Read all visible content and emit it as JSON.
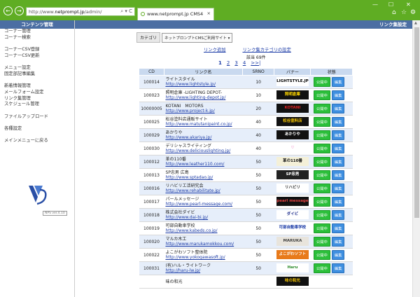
{
  "browser": {
    "url_prefix": "http://www.",
    "url_host": "netprompt.jp",
    "url_path": "/admin/",
    "url_ctl": "⌕ ▾ C",
    "tab_title": "www.netprompt.jp  CMS4",
    "tab_close": "×",
    "win_min": "—",
    "win_max": "☐",
    "win_close": "✕"
  },
  "left": {
    "heading": "コンテンツ管理",
    "menu": [
      [
        "コーナー管理",
        "コーナー検索"
      ],
      [
        "コーナーCSV登録",
        "コーナーCSV更新"
      ],
      [
        "メニュー設定",
        "固定部記事編集"
      ],
      [
        "新着情報管理",
        "メールフォーム設定",
        "リンク集管理",
        "スケジュール管理"
      ],
      [
        "ファイルアップロード"
      ],
      [
        "各種設定"
      ],
      [
        "メインメニューに戻る"
      ]
    ],
    "version": "NPS ver.4.10"
  },
  "main": {
    "heading": "リンク集設定",
    "cat_label": "カテゴリ",
    "cat_value": "ネットプロンプトCMSご利用サイト ▾",
    "add_link": "リンク追加",
    "cat_setting": "リンク集カテゴリの設定",
    "total": "該当 69件",
    "pages": [
      "1",
      "2",
      "3",
      "4",
      ">>|"
    ],
    "cols": [
      "CD",
      "リンク名",
      "SRNO",
      "バナー",
      "状態"
    ],
    "pub_label": "公開中",
    "edit_label": "編集"
  },
  "rows": [
    {
      "cd": "100014",
      "name": "ライトスタイル",
      "url": "http://www.lightstyle.jp/",
      "srno": "10",
      "banner": "LIGHTSTYLE.JP",
      "bg": "#ffffff",
      "fg": "#000000"
    },
    {
      "cd": "100023",
      "name": "照明倉庫 -LIGHTING DEPOT-",
      "url": "http://www.lighting-depot.jp/",
      "srno": "10",
      "banner": "照明倉庫",
      "bg": "#111111",
      "fg": "#ffd700"
    },
    {
      "cd": "10000005",
      "name": "KOTANI　MOTORS",
      "url": "http://www.project-k.jp/",
      "srno": "20",
      "banner": "KOTANI",
      "bg": "#111111",
      "fg": "#e02020"
    },
    {
      "cd": "100025",
      "name": "松谷塗料店通販サイト",
      "url": "http://www.matutanipaint.co.jp/",
      "srno": "40",
      "banner": "松谷塗料店",
      "bg": "#111111",
      "fg": "#f0c000"
    },
    {
      "cd": "100029",
      "name": "あかりや",
      "url": "http://www.akariya.jp/",
      "srno": "40",
      "banner": "あかりや",
      "bg": "#111111",
      "fg": "#ffffff"
    },
    {
      "cd": "100030",
      "name": "デリシャスライティング",
      "url": "http://www.deliciouslighting.jp/",
      "srno": "40",
      "banner": "♡",
      "bg": "#ffffff",
      "fg": "#e0208f"
    },
    {
      "cd": "100012",
      "name": "革の110番",
      "url": "http://www.leather110.com/",
      "srno": "50",
      "banner": "革の110番",
      "bg": "#f4f0d8",
      "fg": "#111111"
    },
    {
      "cd": "100013",
      "name": "SP忠男 広島",
      "url": "http://www.sptadao.jp/",
      "srno": "50",
      "banner": "SP忠男",
      "bg": "#222222",
      "fg": "#ffffff"
    },
    {
      "cd": "100016",
      "name": "リハビリエ活研究会",
      "url": "http://www.rehabilitate.jp/",
      "srno": "50",
      "banner": "リハビリ",
      "bg": "#ffffff",
      "fg": "#333333"
    },
    {
      "cd": "100017",
      "name": "パールメッセージ",
      "url": "http://www.pearl-message.com/",
      "srno": "50",
      "banner": "pearl message",
      "bg": "#111111",
      "fg": "#e04040"
    },
    {
      "cd": "100018",
      "name": "株式会社ダイビ",
      "url": "http://www.dai-bi.jp/",
      "srno": "50",
      "banner": "ダイビ",
      "bg": "#ffffff",
      "fg": "#1a2a8a"
    },
    {
      "cd": "100019",
      "name": "可部自動車学校",
      "url": "http://www.kabeds.co.jp/",
      "srno": "50",
      "banner": "可部自動車学校",
      "bg": "#ffffff",
      "fg": "#1a3aa6"
    },
    {
      "cd": "100020",
      "name": "マルカ木工",
      "url": "http://www.marukamokkou.com/",
      "srno": "50",
      "banner": "MARUKA",
      "bg": "#e8e4dc",
      "fg": "#444444"
    },
    {
      "cd": "100022",
      "name": "よこがわソフト整体院",
      "url": "http://www.yokogawasoft.jp/",
      "srno": "50",
      "banner": "よこがわソフト",
      "bg": "#e87a1a",
      "fg": "#ffffff"
    },
    {
      "cd": "100031",
      "name": "(有)ハル・ライトワーク",
      "url": "http://haru-lw.jp/",
      "srno": "50",
      "banner": "Haru",
      "bg": "#ffffff",
      "fg": "#2a8a2a"
    },
    {
      "cd": "",
      "name": "味の和光",
      "url": "",
      "srno": "",
      "banner": "味の和光",
      "bg": "#111111",
      "fg": "#f0c000"
    }
  ]
}
